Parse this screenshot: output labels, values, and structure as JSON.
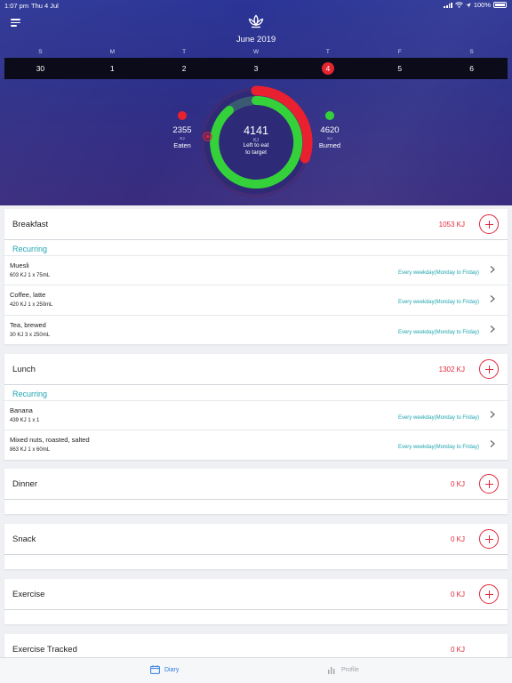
{
  "status_bar": {
    "time": "1:07 pm",
    "date": "Thu 4 Jul",
    "battery": "100%"
  },
  "header": {
    "month": "June 2019"
  },
  "calendar": {
    "weekdays": [
      "S",
      "M",
      "T",
      "W",
      "T",
      "F",
      "S"
    ],
    "days": [
      "30",
      "1",
      "2",
      "3",
      "4",
      "5",
      "6"
    ],
    "selected_index": 4
  },
  "summary": {
    "eaten": {
      "value": "2355",
      "unit": "KJ",
      "label": "Eaten"
    },
    "burned": {
      "value": "4620",
      "unit": "KJ",
      "label": "Burned"
    },
    "left": {
      "value": "4141",
      "unit": "KJ",
      "label_line1": "Left to eat",
      "label_line2": "to target"
    },
    "colors": {
      "eaten": "#e8202f",
      "burned": "#35d13a"
    }
  },
  "meals": {
    "breakfast": {
      "title": "Breakfast",
      "kj": "1053 KJ",
      "recurring": "Recurring",
      "items": [
        {
          "name": "Muesli",
          "qty": "603 KJ  1 x 75mL",
          "freq": "Every weekday(Monday to Friday)"
        },
        {
          "name": "Coffee, latte",
          "qty": "420 KJ  1 x 250mL",
          "freq": "Every weekday(Monday to Friday)"
        },
        {
          "name": "Tea, brewed",
          "qty": "30 KJ  3 x 250mL",
          "freq": "Every weekday(Monday to Friday)"
        }
      ]
    },
    "lunch": {
      "title": "Lunch",
      "kj": "1302 KJ",
      "recurring": "Recurring",
      "items": [
        {
          "name": "Banana",
          "qty": "439 KJ  1 x 1",
          "freq": "Every weekday(Monday to Friday)"
        },
        {
          "name": "Mixed nuts, roasted, salted",
          "qty": "863 KJ  1 x 60mL",
          "freq": "Every weekday(Monday to Friday)"
        }
      ]
    },
    "dinner": {
      "title": "Dinner",
      "kj": "0 KJ"
    },
    "snack": {
      "title": "Snack",
      "kj": "0 KJ"
    },
    "exercise": {
      "title": "Exercise",
      "kj": "0 KJ"
    },
    "exercise_tracked": {
      "title": "Exercise Tracked",
      "kj": "0 KJ"
    }
  },
  "tabbar": {
    "diary": "Diary",
    "profile": "Profile"
  },
  "theme": {
    "accent_red": "#e0283b",
    "teal": "#1fa5ae",
    "tab_active": "#2f7ce0"
  }
}
